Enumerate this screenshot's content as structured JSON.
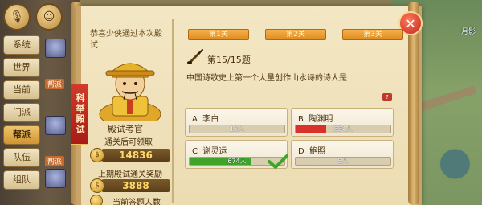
{
  "greeting": "恭喜少侠通过本次殿试！",
  "examiner": {
    "name": "殿试考官",
    "banner": "科举殿试",
    "reward_label": "通关后可领取",
    "reward_value": "14836",
    "last_label": "上期殿试通关奖励",
    "last_value": "3888",
    "bottom_label": "当前答题人数"
  },
  "stage_tabs": [
    "第1关",
    "第2关",
    "第3关"
  ],
  "question": {
    "counter": "第15/15题",
    "text": "中国诗歌史上第一个大量创作山水诗的诗人是"
  },
  "options": [
    {
      "letter": "A",
      "answer": "李白",
      "count": "13人",
      "share": 0.0,
      "bar_color": "#7a8c4a"
    },
    {
      "letter": "B",
      "answer": "陶渊明",
      "count": "334人",
      "share": 0.32,
      "bar_color": "#d8322a"
    },
    {
      "letter": "C",
      "answer": "谢灵运",
      "count": "674人",
      "share": 0.65,
      "bar_color": "#3fa52a",
      "correct": true
    },
    {
      "letter": "D",
      "answer": "鲍照",
      "count": "5人",
      "share": 0.0,
      "bar_color": "#7a8c4a"
    }
  ],
  "side_channels": [
    "系统",
    "世界",
    "当前",
    "门派",
    "帮派",
    "队伍",
    "组队"
  ],
  "active_channel": "帮派",
  "chat_tags": [
    "帮派",
    "帮派"
  ],
  "map_name": "月影",
  "colors": {
    "accent": "#e08a22",
    "correct": "#3fa52a",
    "wrong": "#d8322a"
  }
}
